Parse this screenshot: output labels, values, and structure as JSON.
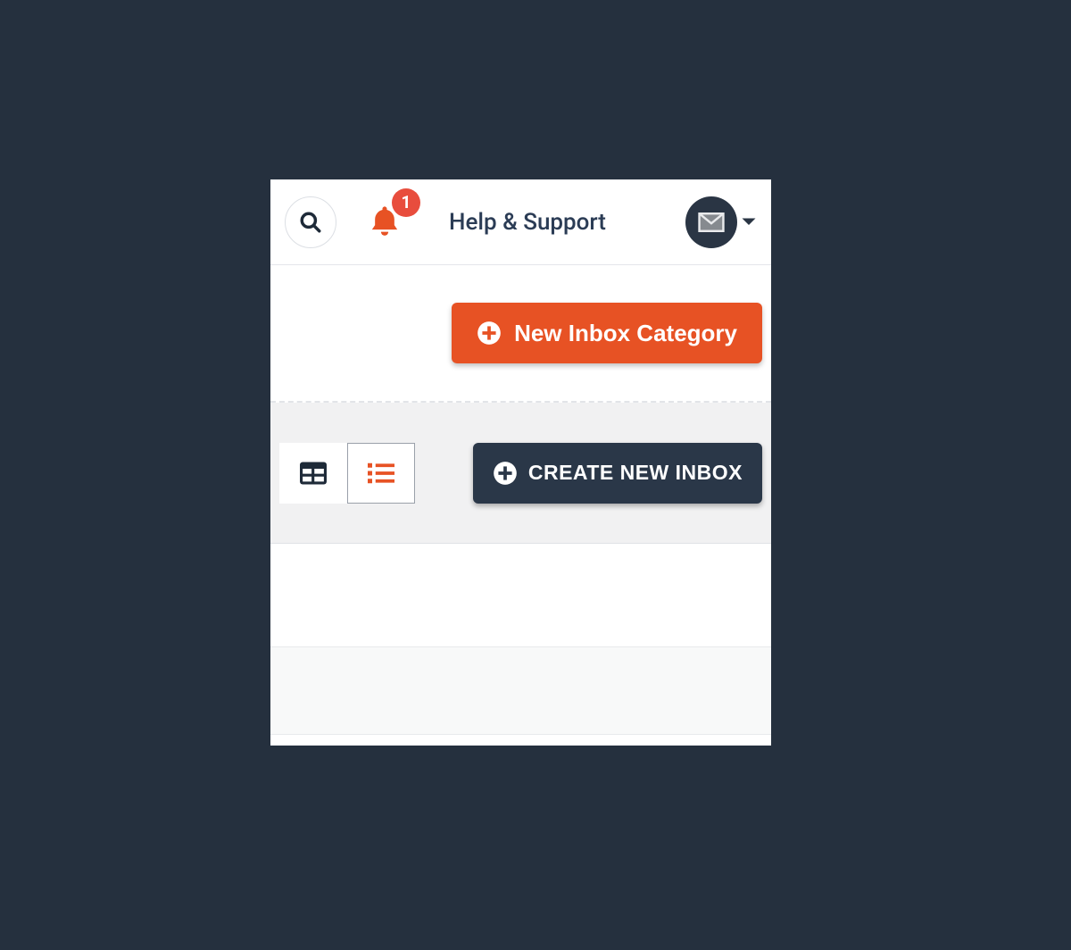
{
  "header": {
    "notification_count": "1",
    "help_label": "Help & Support"
  },
  "actions": {
    "new_category_label": "New Inbox Category",
    "create_inbox_label": "CREATE NEW INBOX"
  },
  "colors": {
    "accent_orange": "#e75224",
    "dark": "#2a3748",
    "badge_red": "#e84d3d"
  }
}
